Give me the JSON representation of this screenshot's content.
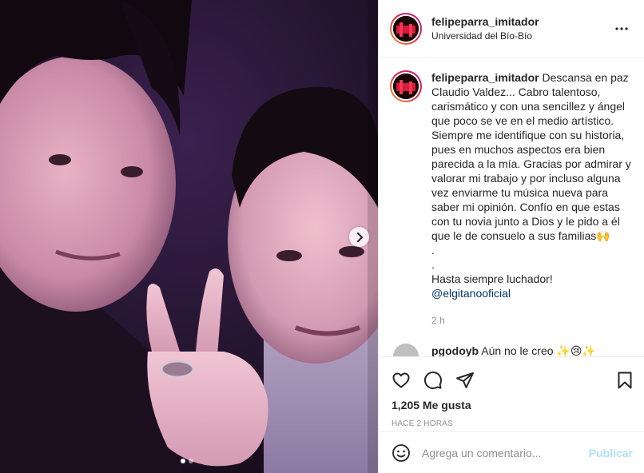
{
  "header": {
    "username": "felipeparra_imitador",
    "location": "Universidad del Bío-Bío"
  },
  "caption": {
    "username": "felipeparra_imitador",
    "text": " Descansa en paz Claudio Valdez... Cabro talentoso, carismático y con una sencillez y ángel que poco se ve en el medio artístico. Siempre me identifique con su historia, pues en muchos aspectos era bien parecida a la mía. Gracias por admirar y valorar mi trabajo y por incluso alguna vez enviarme tu música nueva para saber mi opinión. Confío en que estas con tu novia junto a Dios y le pido a él que le de consuelo a sus familias🙌\n.\n.\nHasta siempre luchador!\n",
    "mention": "@elgitanooficial",
    "time": "2 h"
  },
  "comment": {
    "username": "pgodoyb",
    "text": "Aún no le creo ✨😢✨"
  },
  "likes": "1,205 Me gusta",
  "timestamp": "HACE 2 HORAS",
  "add_comment": {
    "placeholder": "Agrega un comentario...",
    "post_label": "Publicar"
  },
  "icons": {
    "like": "heart-icon",
    "comment": "comment-icon",
    "share": "paper-plane-icon",
    "save": "bookmark-icon",
    "more": "more-horizontal-icon",
    "emoji": "smiley-icon",
    "next": "chevron-right-icon"
  },
  "carousel": {
    "count": 2,
    "active": 1
  },
  "colors": {
    "link": "#00376b",
    "muted": "#8e8e8e",
    "post_disabled": "#b2dffc"
  }
}
